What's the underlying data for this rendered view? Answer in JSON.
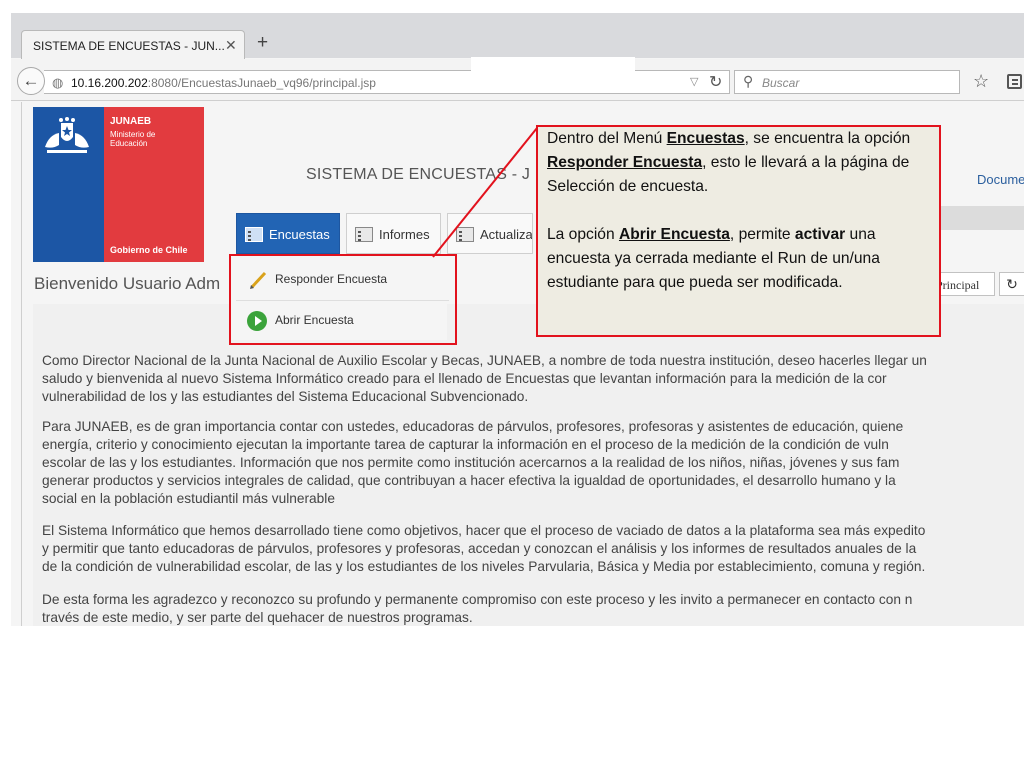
{
  "browser": {
    "tab_title": "SISTEMA DE ENCUESTAS - JUN...",
    "url_host": "10.16.200.202",
    "url_rest": ":8080/EncuestasJunaeb_vq96/principal.jsp",
    "search_placeholder": "Buscar"
  },
  "logo": {
    "name": "JUNAEB",
    "ministry": "Ministerio de\nEducación",
    "gov": "Gobierno de Chile"
  },
  "page": {
    "system_title": "SISTEMA DE ENCUESTAS - J",
    "doc_link": "Docume",
    "welcome": "Bienvenido Usuario Adm",
    "principal_button": "Principal",
    "tabs": [
      {
        "label": "Encuestas"
      },
      {
        "label": "Informes"
      },
      {
        "label": "Actualiza"
      }
    ],
    "dropdown": [
      {
        "label": "Responder Encuesta"
      },
      {
        "label": "Abrir Encuesta"
      }
    ],
    "paragraphs": [
      [
        "Como Director Nacional de la Junta Nacional de Auxilio Escolar y Becas, JUNAEB, a nombre de toda nuestra institución, deseo hacerles llegar un",
        "saludo y bienvenida al nuevo Sistema Informático creado para el llenado de Encuestas que levantan información para la medición de la cor",
        "vulnerabilidad de los y las estudiantes del Sistema Educacional Subvencionado."
      ],
      [
        "Para JUNAEB, es de gran importancia contar con ustedes, educadoras de párvulos, profesores, profesoras y asistentes de educación, quiene",
        "energía, criterio y conocimiento ejecutan la importante tarea de capturar la información en el proceso de la medición de la condición de vuln",
        "escolar de las y los estudiantes. Información que nos permite como institución acercarnos a la realidad de los niños, niñas, jóvenes y sus fam",
        "generar productos y servicios integrales de calidad, que contribuyan a hacer efectiva la igualdad de oportunidades, el desarrollo humano y la",
        "social en la población estudiantil más vulnerable"
      ],
      [
        "El Sistema Informático que hemos desarrollado tiene como objetivos, hacer que el proceso de vaciado de datos a la plataforma sea más expedito",
        "y permitir que tanto educadoras de párvulos, profesores y profesoras, accedan y conozcan el análisis y los informes de resultados anuales de la",
        "de la condición de vulnerabilidad escolar, de las y los estudiantes de los niveles Parvularia, Básica y Media por establecimiento, comuna y región."
      ],
      [
        "De esta forma les agradezco y reconozco su profundo y permanente compromiso con este proceso y les invito a permanecer en contacto con n",
        "través de este medio, y ser parte del quehacer de nuestros programas."
      ]
    ]
  },
  "callout": {
    "p1_a": "Dentro del Menú ",
    "p1_b": "Encuestas",
    "p1_c": ", se encuentra la opción ",
    "p1_d": "Responder Encuesta",
    "p1_e": ", esto le llevará  a la página de Selección de encuesta.",
    "p2_a": "La opción ",
    "p2_b": "Abrir Encuesta",
    "p2_c": ", permite ",
    "p2_d": "activar",
    "p2_e": " una encuesta  ya cerrada mediante el Run de un/una estudiante  para que pueda ser modificada."
  },
  "colors": {
    "accent_red": "#e2121d",
    "menu_blue": "#2264b4",
    "logo_blue": "#1c56a5",
    "logo_red": "#e23b3f"
  }
}
